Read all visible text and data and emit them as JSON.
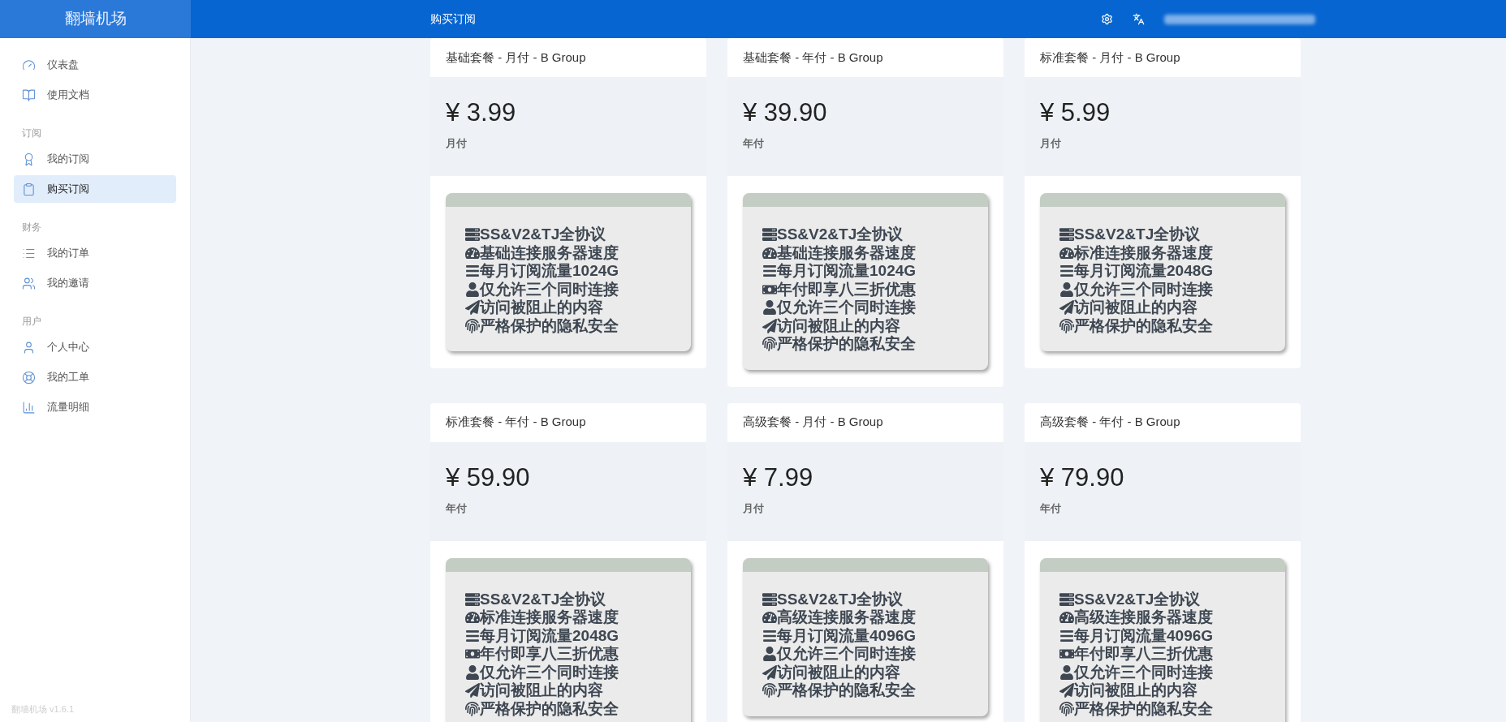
{
  "brand": "翻墙机场",
  "header": {
    "title": "购买订阅"
  },
  "sidebar": {
    "sections": [
      {
        "items": [
          {
            "label": "仪表盘",
            "selected": false
          },
          {
            "label": "使用文档",
            "selected": false
          }
        ]
      },
      {
        "heading": "订阅",
        "items": [
          {
            "label": "我的订阅",
            "selected": false
          },
          {
            "label": "购买订阅",
            "selected": true
          }
        ]
      },
      {
        "heading": "财务",
        "items": [
          {
            "label": "我的订单",
            "selected": false
          },
          {
            "label": "我的邀请",
            "selected": false
          }
        ]
      },
      {
        "heading": "用户",
        "items": [
          {
            "label": "个人中心",
            "selected": false
          },
          {
            "label": "我的工单",
            "selected": false
          },
          {
            "label": "流量明细",
            "selected": false
          }
        ]
      }
    ],
    "version": "翻墙机场 v1.6.1"
  },
  "plans": [
    {
      "title": "基础套餐 - 月付 - B Group",
      "price": "¥ 3.99",
      "period": "月付",
      "features": [
        {
          "kind": "server",
          "text": "SS&V2&TJ全协议"
        },
        {
          "kind": "speed",
          "text": "基础连接服务器速度"
        },
        {
          "kind": "bars",
          "text": "每月订阅流量1024G"
        },
        {
          "kind": "user",
          "text": "仅允许三个同时连接"
        },
        {
          "kind": "plane",
          "text": "访问被阻止的内容"
        },
        {
          "kind": "fingerprint",
          "text": "严格保护的隐私安全"
        }
      ]
    },
    {
      "title": "基础套餐 - 年付 - B Group",
      "price": "¥ 39.90",
      "period": "年付",
      "features": [
        {
          "kind": "server",
          "text": "SS&V2&TJ全协议"
        },
        {
          "kind": "speed",
          "text": "基础连接服务器速度"
        },
        {
          "kind": "bars",
          "text": "每月订阅流量1024G"
        },
        {
          "kind": "money",
          "text": "年付即享八三折优惠"
        },
        {
          "kind": "user",
          "text": "仅允许三个同时连接"
        },
        {
          "kind": "plane",
          "text": "访问被阻止的内容"
        },
        {
          "kind": "fingerprint",
          "text": "严格保护的隐私安全"
        }
      ]
    },
    {
      "title": "标准套餐 - 月付 - B Group",
      "price": "¥ 5.99",
      "period": "月付",
      "features": [
        {
          "kind": "server",
          "text": "SS&V2&TJ全协议"
        },
        {
          "kind": "speed",
          "text": "标准连接服务器速度"
        },
        {
          "kind": "bars",
          "text": "每月订阅流量2048G"
        },
        {
          "kind": "user",
          "text": "仅允许三个同时连接"
        },
        {
          "kind": "plane",
          "text": "访问被阻止的内容"
        },
        {
          "kind": "fingerprint",
          "text": "严格保护的隐私安全"
        }
      ]
    },
    {
      "title": "标准套餐 - 年付 - B Group",
      "price": "¥ 59.90",
      "period": "年付",
      "features": [
        {
          "kind": "server",
          "text": "SS&V2&TJ全协议"
        },
        {
          "kind": "speed",
          "text": "标准连接服务器速度"
        },
        {
          "kind": "bars",
          "text": "每月订阅流量2048G"
        },
        {
          "kind": "money",
          "text": "年付即享八三折优惠"
        },
        {
          "kind": "user",
          "text": "仅允许三个同时连接"
        },
        {
          "kind": "plane",
          "text": "访问被阻止的内容"
        },
        {
          "kind": "fingerprint",
          "text": "严格保护的隐私安全"
        }
      ]
    },
    {
      "title": "高级套餐 - 月付 - B Group",
      "price": "¥ 7.99",
      "period": "月付",
      "features": [
        {
          "kind": "server",
          "text": "SS&V2&TJ全协议"
        },
        {
          "kind": "speed",
          "text": "高级连接服务器速度"
        },
        {
          "kind": "bars",
          "text": "每月订阅流量4096G"
        },
        {
          "kind": "user",
          "text": "仅允许三个同时连接"
        },
        {
          "kind": "plane",
          "text": "访问被阻止的内容"
        },
        {
          "kind": "fingerprint",
          "text": "严格保护的隐私安全"
        }
      ]
    },
    {
      "title": "高级套餐 - 年付 - B Group",
      "price": "¥ 79.90",
      "period": "年付",
      "features": [
        {
          "kind": "server",
          "text": "SS&V2&TJ全协议"
        },
        {
          "kind": "speed",
          "text": "高级连接服务器速度"
        },
        {
          "kind": "bars",
          "text": "每月订阅流量4096G"
        },
        {
          "kind": "money",
          "text": "年付即享八三折优惠"
        },
        {
          "kind": "user",
          "text": "仅允许三个同时连接"
        },
        {
          "kind": "plane",
          "text": "访问被阻止的内容"
        },
        {
          "kind": "fingerprint",
          "text": "严格保护的隐私安全"
        }
      ]
    }
  ]
}
